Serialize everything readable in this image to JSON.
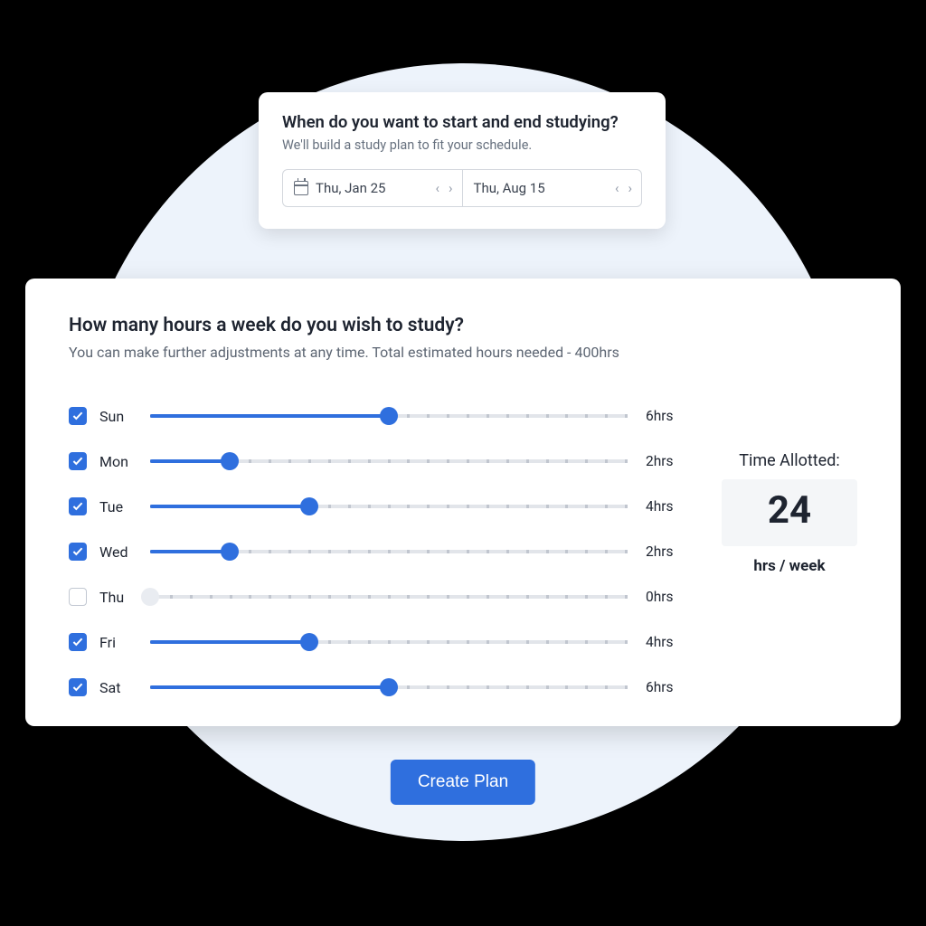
{
  "top_card": {
    "title": "When do you want to start and end studying?",
    "subtitle": "We'll build a study plan to fit your schedule.",
    "start_date": "Thu, Jan 25",
    "end_date": "Thu, Aug 15"
  },
  "main_card": {
    "title": "How many hours a week do you wish to study?",
    "subtitle": "You can make further adjustments at any time. Total estimated hours needed - 400hrs",
    "slider_max": 12,
    "days": [
      {
        "label": "Sun",
        "checked": true,
        "hours": 6,
        "display": "6hrs"
      },
      {
        "label": "Mon",
        "checked": true,
        "hours": 2,
        "display": "2hrs"
      },
      {
        "label": "Tue",
        "checked": true,
        "hours": 4,
        "display": "4hrs"
      },
      {
        "label": "Wed",
        "checked": true,
        "hours": 2,
        "display": "2hrs"
      },
      {
        "label": "Thu",
        "checked": false,
        "hours": 0,
        "display": "0hrs"
      },
      {
        "label": "Fri",
        "checked": true,
        "hours": 4,
        "display": "4hrs"
      },
      {
        "label": "Sat",
        "checked": true,
        "hours": 6,
        "display": "6hrs"
      }
    ]
  },
  "allotted": {
    "title": "Time Allotted:",
    "value": "24",
    "unit": "hrs / week"
  },
  "button": {
    "label": "Create Plan"
  }
}
